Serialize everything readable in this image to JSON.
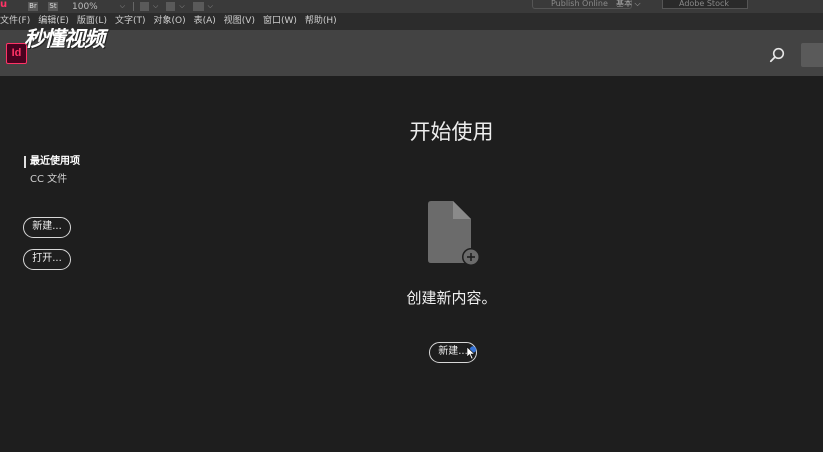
{
  "toolbar": {
    "logo": "u",
    "br_label": "Br",
    "st_label": "St",
    "zoom": "100%",
    "publish_online": "Publish Online",
    "workspace": "基本",
    "stock_placeholder": "Adobe Stock"
  },
  "menu": [
    "文件(F)",
    "编辑(E)",
    "版面(L)",
    "文字(T)",
    "对象(O)",
    "表(A)",
    "视图(V)",
    "窗口(W)",
    "帮助(H)"
  ],
  "header": {
    "app_icon_label": "Id",
    "watermark": "秒懂视频"
  },
  "nav": {
    "recent": "最近使用项",
    "cc_files": "CC 文件"
  },
  "buttons": {
    "new_left": "新建...",
    "open_left": "打开...",
    "new_center": "新建..."
  },
  "main": {
    "title": "开始使用",
    "subtitle": "创建新内容。"
  },
  "colors": {
    "accent": "#ff3366",
    "header_bg": "#434343",
    "main_bg": "#1e1e1e"
  }
}
